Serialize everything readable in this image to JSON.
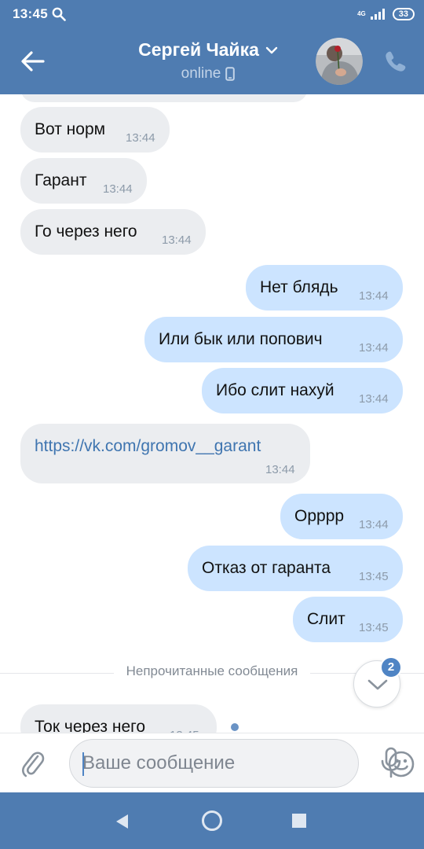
{
  "status_bar": {
    "time": "13:45",
    "network_top": "4G",
    "battery": "33"
  },
  "header": {
    "contact_name": "Сергей Чайка",
    "status": "online"
  },
  "messages": [
    {
      "dir": "in",
      "text": "Вот норм",
      "time": "13:44"
    },
    {
      "dir": "in",
      "text": "Гарант",
      "time": "13:44"
    },
    {
      "dir": "in",
      "text": "Го через него",
      "time": "13:44"
    },
    {
      "dir": "out",
      "text": "Нет блядь",
      "time": "13:44"
    },
    {
      "dir": "out",
      "text": "Или бык или попович",
      "time": "13:44"
    },
    {
      "dir": "out",
      "text": "Ибо слит нахуй",
      "time": "13:44"
    },
    {
      "dir": "in",
      "text": "https://vk.com/gromov__garant",
      "time": "13:44",
      "is_link": true
    },
    {
      "dir": "out",
      "text": "Орррр",
      "time": "13:44"
    },
    {
      "dir": "out",
      "text": "Отказ от гаранта",
      "time": "13:45"
    },
    {
      "dir": "out",
      "text": "Слит",
      "time": "13:45"
    },
    {
      "dir": "in",
      "text": "Ток через него",
      "time": "13:45"
    }
  ],
  "unread_separator": "Непрочитанные сообщения",
  "scroll_badge": "2",
  "composer": {
    "placeholder": "Ваше сообщение"
  },
  "colors": {
    "header": "#4f7cb1",
    "incoming_bubble": "#ebedf0",
    "outgoing_bubble": "#cce4ff",
    "link": "#3f75b0",
    "badge": "#4f84c4"
  }
}
